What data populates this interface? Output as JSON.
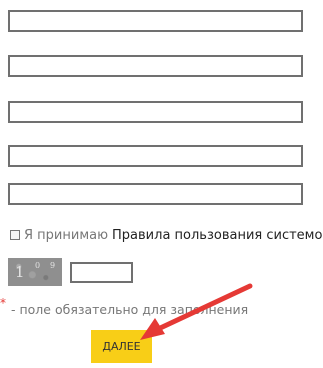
{
  "form": {
    "fields": [
      "",
      "",
      "",
      "",
      ""
    ]
  },
  "agreement": {
    "text": "Я принимаю",
    "link": "Правила пользования системой"
  },
  "captcha": {
    "digit_1": "1",
    "digit_2": "0",
    "digit_3": "9",
    "input_value": ""
  },
  "required_note": {
    "star": "*",
    "text": "- поле обязательно для заполнения"
  },
  "submit": {
    "label": "ДАЛЕЕ"
  },
  "colors": {
    "button": "#f8ce17",
    "required_star": "#e53935",
    "arrow": "#e53935"
  }
}
